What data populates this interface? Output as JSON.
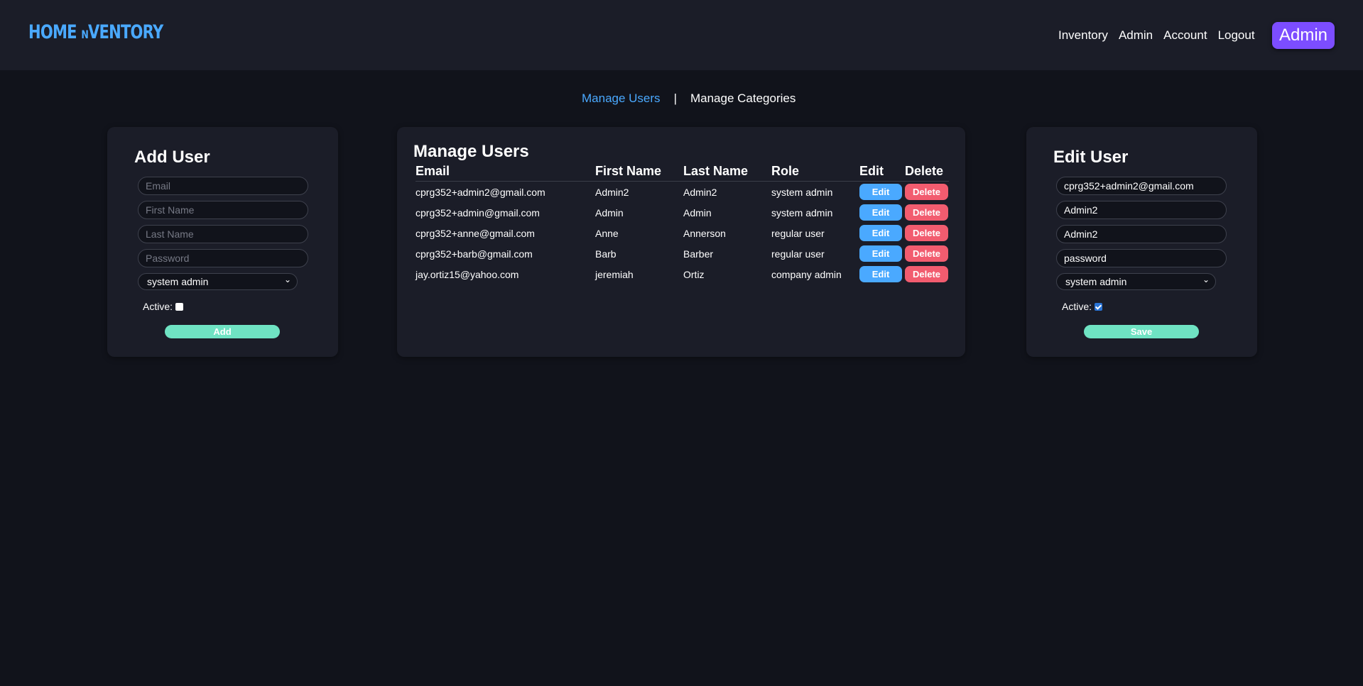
{
  "header": {
    "logo_main": "HOME",
    "logo_small": "N",
    "logo_tail": "VENTORY",
    "nav": [
      "Inventory",
      "Admin",
      "Account",
      "Logout"
    ],
    "badge": "Admin"
  },
  "subnav": {
    "active": "Manage Users",
    "separator": "|",
    "other": "Manage Categories"
  },
  "add_user": {
    "title": "Add User",
    "email_placeholder": "Email",
    "first_placeholder": "First Name",
    "last_placeholder": "Last Name",
    "password_placeholder": "Password",
    "role": "system admin",
    "active_label": "Active:",
    "active": false,
    "button": "Add"
  },
  "manage": {
    "title": "Manage Users",
    "headers": [
      "Email",
      "First Name",
      "Last Name",
      "Role",
      "Edit",
      "Delete"
    ],
    "edit_label": "Edit",
    "delete_label": "Delete",
    "rows": [
      {
        "email": "cprg352+admin2@gmail.com",
        "first": "Admin2",
        "last": "Admin2",
        "role": "system admin"
      },
      {
        "email": "cprg352+admin@gmail.com",
        "first": "Admin",
        "last": "Admin",
        "role": "system admin"
      },
      {
        "email": "cprg352+anne@gmail.com",
        "first": "Anne",
        "last": "Annerson",
        "role": "regular user"
      },
      {
        "email": "cprg352+barb@gmail.com",
        "first": "Barb",
        "last": "Barber",
        "role": "regular user"
      },
      {
        "email": "jay.ortiz15@yahoo.com",
        "first": "jeremiah",
        "last": "Ortiz",
        "role": "company admin"
      }
    ]
  },
  "edit_user": {
    "title": "Edit User",
    "email": "cprg352+admin2@gmail.com",
    "first": "Admin2",
    "last": "Admin2",
    "password": "password",
    "role": "system admin",
    "active_label": "Active:",
    "active": true,
    "button": "Save"
  },
  "colors": {
    "background": "#11131b",
    "panel": "#1b1d28",
    "accent_blue": "#4aa9ff",
    "admin_badge": "#7c4dff",
    "add_button": "#6fe3c3",
    "delete_button": "#f25c6f"
  }
}
